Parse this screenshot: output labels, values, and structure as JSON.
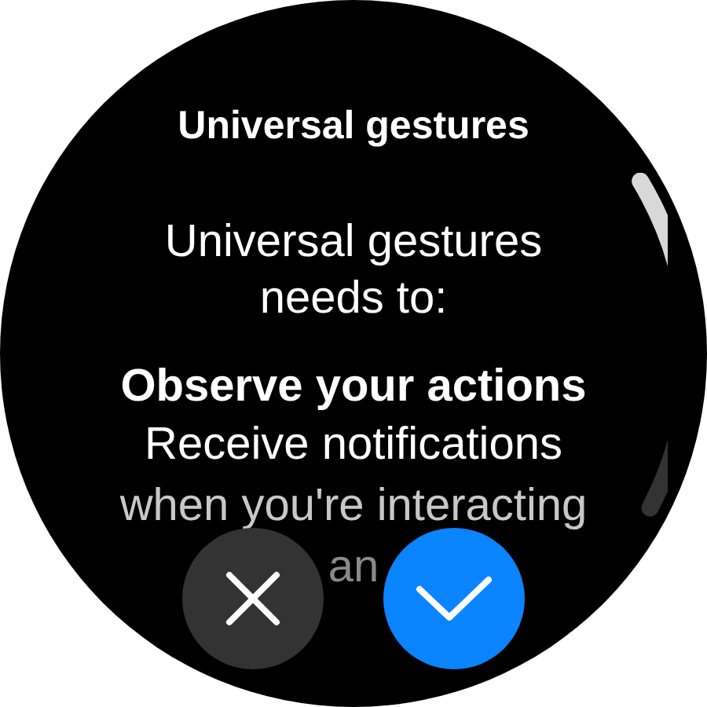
{
  "title": "Universal gestures",
  "intro": "Universal gestures needs to:",
  "permissions": [
    {
      "title": "Observe your actions",
      "description_lines": [
        "Receive notifications",
        "when you're interacting",
        "an"
      ]
    }
  ],
  "buttons": [
    {
      "kind": "cancel"
    },
    {
      "kind": "confirm"
    }
  ]
}
